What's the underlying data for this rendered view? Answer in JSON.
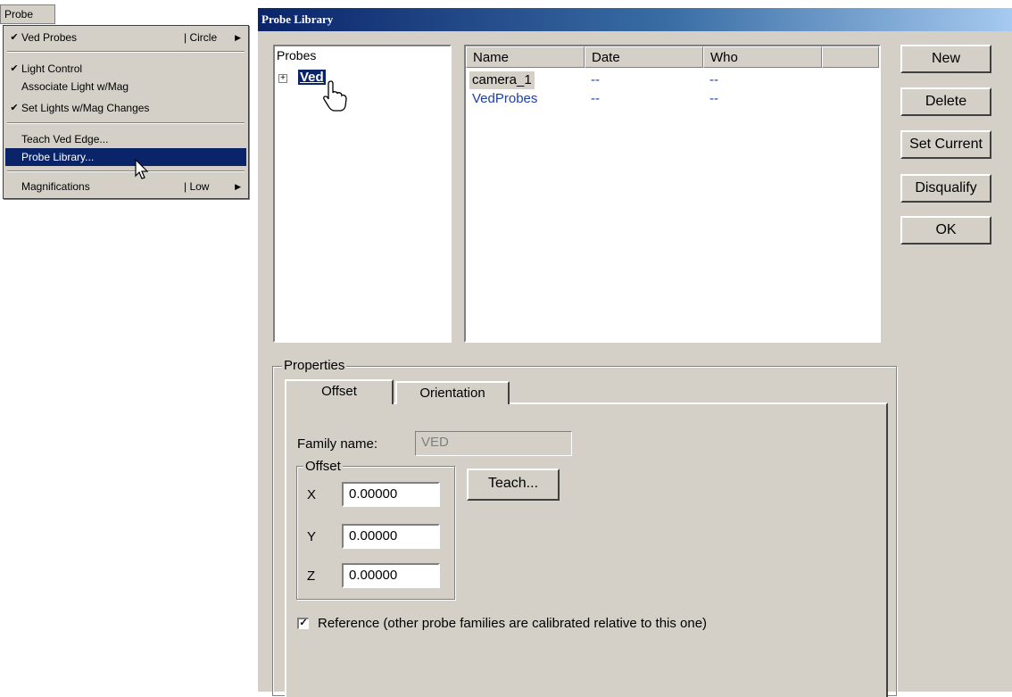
{
  "menubar": {
    "probe_label": "Probe"
  },
  "menu": {
    "items": [
      {
        "check": "✔",
        "label": "Ved Probes",
        "submenu": "| Circle",
        "arrow": "▶"
      },
      {
        "check": "✔",
        "label": "Light Control"
      },
      {
        "check": "",
        "label": "Associate Light w/Mag"
      },
      {
        "check": "✔",
        "label": "Set Lights w/Mag Changes"
      },
      {
        "check": "",
        "label": "Teach Ved Edge..."
      },
      {
        "check": "",
        "label": "Probe Library..."
      },
      {
        "check": "",
        "label": "Magnifications",
        "submenu": "| Low",
        "arrow": "▶"
      }
    ]
  },
  "dialog": {
    "title": "Probe Library",
    "tree": {
      "root_label": "Probes",
      "expander": "+",
      "node_label": "Ved"
    },
    "list": {
      "columns": [
        "Name",
        "Date",
        "Who"
      ],
      "rows": [
        {
          "name": "camera_1",
          "date": "--",
          "who": "--"
        },
        {
          "name": "VedProbes",
          "date": "--",
          "who": "--"
        }
      ]
    },
    "buttons": {
      "new": "New",
      "delete": "Delete",
      "set_current": "Set Current",
      "disqualify": "Disqualify",
      "ok": "OK"
    },
    "properties": {
      "group_label": "Properties",
      "tabs": [
        "Offset",
        "Orientation"
      ],
      "family_name_label": "Family name:",
      "family_name_value": "VED",
      "offset_group_label": "Offset",
      "x_label": "X",
      "x_value": "0.00000",
      "y_label": "Y",
      "y_value": "0.00000",
      "z_label": "Z",
      "z_value": "0.00000",
      "teach_button": "Teach...",
      "reference_check": "✓",
      "reference_label": "Reference (other probe families are calibrated relative to this one)"
    }
  },
  "colors": {
    "selection": "#0a246a",
    "face": "#d4d0c8",
    "list_link": "#1c3fa8"
  }
}
